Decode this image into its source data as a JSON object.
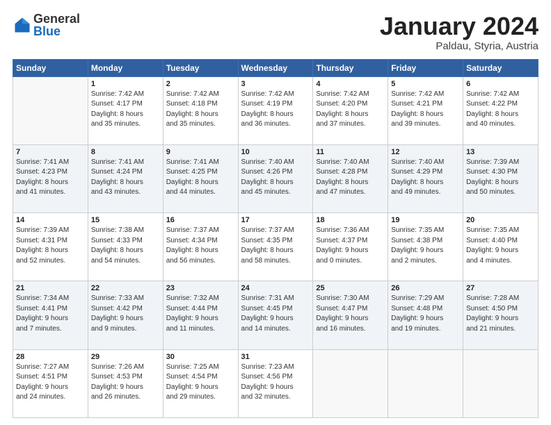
{
  "header": {
    "logo_general": "General",
    "logo_blue": "Blue",
    "title": "January 2024",
    "location": "Paldau, Styria, Austria"
  },
  "weekdays": [
    "Sunday",
    "Monday",
    "Tuesday",
    "Wednesday",
    "Thursday",
    "Friday",
    "Saturday"
  ],
  "weeks": [
    [
      {
        "day": "",
        "info": ""
      },
      {
        "day": "1",
        "info": "Sunrise: 7:42 AM\nSunset: 4:17 PM\nDaylight: 8 hours\nand 35 minutes."
      },
      {
        "day": "2",
        "info": "Sunrise: 7:42 AM\nSunset: 4:18 PM\nDaylight: 8 hours\nand 35 minutes."
      },
      {
        "day": "3",
        "info": "Sunrise: 7:42 AM\nSunset: 4:19 PM\nDaylight: 8 hours\nand 36 minutes."
      },
      {
        "day": "4",
        "info": "Sunrise: 7:42 AM\nSunset: 4:20 PM\nDaylight: 8 hours\nand 37 minutes."
      },
      {
        "day": "5",
        "info": "Sunrise: 7:42 AM\nSunset: 4:21 PM\nDaylight: 8 hours\nand 39 minutes."
      },
      {
        "day": "6",
        "info": "Sunrise: 7:42 AM\nSunset: 4:22 PM\nDaylight: 8 hours\nand 40 minutes."
      }
    ],
    [
      {
        "day": "7",
        "info": "Sunrise: 7:41 AM\nSunset: 4:23 PM\nDaylight: 8 hours\nand 41 minutes."
      },
      {
        "day": "8",
        "info": "Sunrise: 7:41 AM\nSunset: 4:24 PM\nDaylight: 8 hours\nand 43 minutes."
      },
      {
        "day": "9",
        "info": "Sunrise: 7:41 AM\nSunset: 4:25 PM\nDaylight: 8 hours\nand 44 minutes."
      },
      {
        "day": "10",
        "info": "Sunrise: 7:40 AM\nSunset: 4:26 PM\nDaylight: 8 hours\nand 45 minutes."
      },
      {
        "day": "11",
        "info": "Sunrise: 7:40 AM\nSunset: 4:28 PM\nDaylight: 8 hours\nand 47 minutes."
      },
      {
        "day": "12",
        "info": "Sunrise: 7:40 AM\nSunset: 4:29 PM\nDaylight: 8 hours\nand 49 minutes."
      },
      {
        "day": "13",
        "info": "Sunrise: 7:39 AM\nSunset: 4:30 PM\nDaylight: 8 hours\nand 50 minutes."
      }
    ],
    [
      {
        "day": "14",
        "info": "Sunrise: 7:39 AM\nSunset: 4:31 PM\nDaylight: 8 hours\nand 52 minutes."
      },
      {
        "day": "15",
        "info": "Sunrise: 7:38 AM\nSunset: 4:33 PM\nDaylight: 8 hours\nand 54 minutes."
      },
      {
        "day": "16",
        "info": "Sunrise: 7:37 AM\nSunset: 4:34 PM\nDaylight: 8 hours\nand 56 minutes."
      },
      {
        "day": "17",
        "info": "Sunrise: 7:37 AM\nSunset: 4:35 PM\nDaylight: 8 hours\nand 58 minutes."
      },
      {
        "day": "18",
        "info": "Sunrise: 7:36 AM\nSunset: 4:37 PM\nDaylight: 9 hours\nand 0 minutes."
      },
      {
        "day": "19",
        "info": "Sunrise: 7:35 AM\nSunset: 4:38 PM\nDaylight: 9 hours\nand 2 minutes."
      },
      {
        "day": "20",
        "info": "Sunrise: 7:35 AM\nSunset: 4:40 PM\nDaylight: 9 hours\nand 4 minutes."
      }
    ],
    [
      {
        "day": "21",
        "info": "Sunrise: 7:34 AM\nSunset: 4:41 PM\nDaylight: 9 hours\nand 7 minutes."
      },
      {
        "day": "22",
        "info": "Sunrise: 7:33 AM\nSunset: 4:42 PM\nDaylight: 9 hours\nand 9 minutes."
      },
      {
        "day": "23",
        "info": "Sunrise: 7:32 AM\nSunset: 4:44 PM\nDaylight: 9 hours\nand 11 minutes."
      },
      {
        "day": "24",
        "info": "Sunrise: 7:31 AM\nSunset: 4:45 PM\nDaylight: 9 hours\nand 14 minutes."
      },
      {
        "day": "25",
        "info": "Sunrise: 7:30 AM\nSunset: 4:47 PM\nDaylight: 9 hours\nand 16 minutes."
      },
      {
        "day": "26",
        "info": "Sunrise: 7:29 AM\nSunset: 4:48 PM\nDaylight: 9 hours\nand 19 minutes."
      },
      {
        "day": "27",
        "info": "Sunrise: 7:28 AM\nSunset: 4:50 PM\nDaylight: 9 hours\nand 21 minutes."
      }
    ],
    [
      {
        "day": "28",
        "info": "Sunrise: 7:27 AM\nSunset: 4:51 PM\nDaylight: 9 hours\nand 24 minutes."
      },
      {
        "day": "29",
        "info": "Sunrise: 7:26 AM\nSunset: 4:53 PM\nDaylight: 9 hours\nand 26 minutes."
      },
      {
        "day": "30",
        "info": "Sunrise: 7:25 AM\nSunset: 4:54 PM\nDaylight: 9 hours\nand 29 minutes."
      },
      {
        "day": "31",
        "info": "Sunrise: 7:23 AM\nSunset: 4:56 PM\nDaylight: 9 hours\nand 32 minutes."
      },
      {
        "day": "",
        "info": ""
      },
      {
        "day": "",
        "info": ""
      },
      {
        "day": "",
        "info": ""
      }
    ]
  ]
}
